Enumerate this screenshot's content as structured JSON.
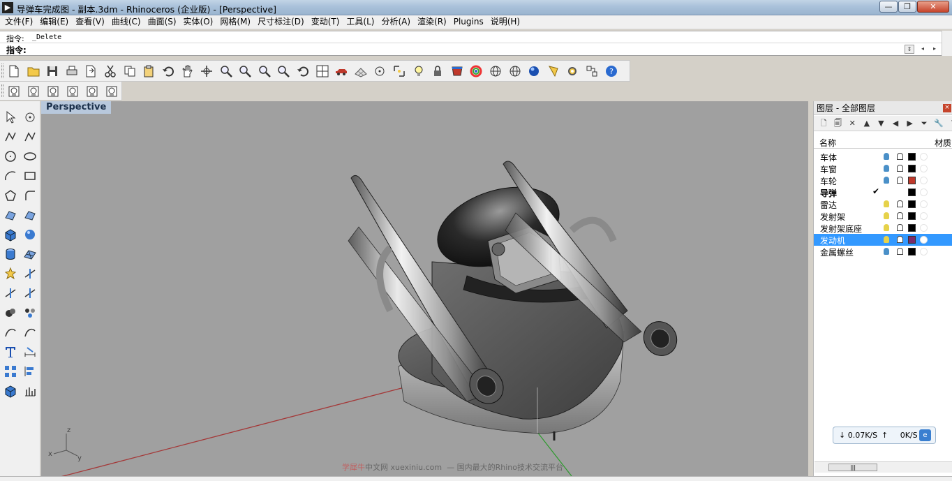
{
  "window": {
    "title": "导弹车完成图 - 副本.3dm - Rhinoceros (企业版) - [Perspective]",
    "minimize_glyph": "—",
    "maximize_glyph": "❐",
    "close_glyph": "✕"
  },
  "menu": [
    "文件(F)",
    "编辑(E)",
    "查看(V)",
    "曲线(C)",
    "曲面(S)",
    "实体(O)",
    "网格(M)",
    "尺寸标注(D)",
    "变动(T)",
    "工具(L)",
    "分析(A)",
    "渲染(R)",
    "Plugins",
    "说明(H)"
  ],
  "command": {
    "history_label": "指令:",
    "history_value": "_Delete",
    "prompt_label": "指令:",
    "prompt_value": ""
  },
  "toolbar_icons": [
    "new-file-icon",
    "open-file-icon",
    "save-icon",
    "print-icon",
    "import-icon",
    "cut-icon",
    "copy-icon",
    "paste-icon",
    "undo-icon",
    "pan-hand-icon",
    "rotate-view-icon",
    "zoom-icon",
    "zoom-window-icon",
    "zoom-extents-icon",
    "zoom-selected-icon",
    "undo-view-icon",
    "four-viewports-icon",
    "car-icon",
    "grid-plane-icon",
    "osnap-icon",
    "cplane-icon",
    "light-icon",
    "lock-icon",
    "material-icon",
    "color-wheel-icon",
    "wireframe-sphere-icon",
    "mesh-sphere-icon",
    "rendered-sphere-icon",
    "render-icon",
    "options-gear-icon",
    "select-filter-icon",
    "help-icon"
  ],
  "toolbar2_icons": [
    "viewport-a-icon",
    "viewport-b-icon",
    "viewport-c-icon",
    "viewport-d-icon",
    "viewport-e-icon",
    "viewport-f-icon"
  ],
  "left_toolbar_icons": [
    "select-arrow-icon",
    "point-icon",
    "polyline-icon",
    "curve-points-icon",
    "circle-icon",
    "ellipse-icon",
    "arc-icon",
    "rectangle-icon",
    "polygon-icon",
    "fillet-curve-icon",
    "surface-icon",
    "loft-icon",
    "box-icon",
    "solid-sphere-icon",
    "cylinder-icon",
    "mesh-plane-icon",
    "explode-icon",
    "trim-icon",
    "split-icon",
    "extend-icon",
    "boolean-union-icon",
    "group-icon",
    "blend-curve-icon",
    "offset-icon",
    "text-icon",
    "dimension-icon",
    "array-icon",
    "align-icon",
    "solid-box-icon",
    "analysis-icon"
  ],
  "viewport": {
    "label": "Perspective",
    "axis_x": "x",
    "axis_y": "y",
    "axis_z": "z"
  },
  "watermark": {
    "brand": "学犀牛",
    "site": "中文网  xuexiniu.com",
    "slogan": "—  国内最大的Rhino技术交流平台"
  },
  "layers_panel": {
    "title": "图层 - 全部图层",
    "col_name": "名称",
    "col_material": "材质",
    "tool_icons": [
      "new-layer-icon",
      "new-sublayer-icon",
      "delete-layer-icon",
      "move-up-icon",
      "move-down-icon",
      "move-left-icon",
      "move-right-icon",
      "filter-icon",
      "tools-icon",
      "help-icon"
    ],
    "rows": [
      {
        "name": "车体",
        "on": true,
        "color": "#000000",
        "current": false,
        "selected": false
      },
      {
        "name": "车窗",
        "on": true,
        "color": "#000000",
        "current": false,
        "selected": false
      },
      {
        "name": "车轮",
        "on": true,
        "color": "#c0392b",
        "current": false,
        "selected": false
      },
      {
        "name": "导弹",
        "on": true,
        "color": "#000000",
        "current": true,
        "selected": false,
        "check": "✔"
      },
      {
        "name": "雷达",
        "on": false,
        "color": "#000000",
        "current": false,
        "selected": false
      },
      {
        "name": "发射架",
        "on": false,
        "color": "#000000",
        "current": false,
        "selected": false
      },
      {
        "name": "发射架底座",
        "on": false,
        "color": "#000000",
        "current": false,
        "selected": false
      },
      {
        "name": "发动机",
        "on": false,
        "color": "#7a2a6a",
        "current": false,
        "selected": true
      },
      {
        "name": "金属螺丝",
        "on": true,
        "color": "#000000",
        "current": false,
        "selected": false
      }
    ]
  },
  "network": {
    "download": "0.07K/S",
    "upload": "0K/S"
  },
  "colors": {
    "selected_row": "#3399ff",
    "viewport_bg": "#a0a0a0",
    "viewport_tab": "#b8c8dc",
    "bulb_on": "#4a90c8",
    "bulb_off": "#e6d24a"
  }
}
